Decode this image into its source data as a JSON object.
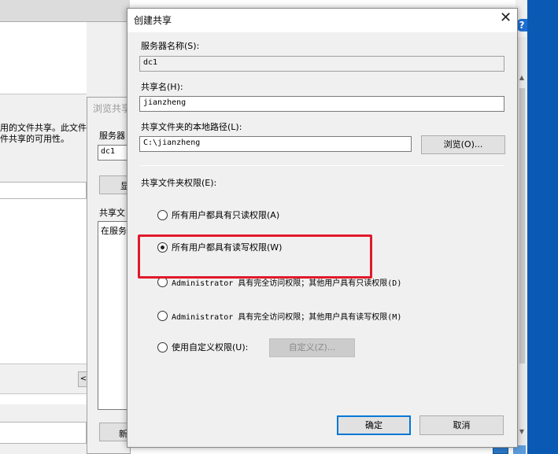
{
  "background": {
    "description_lines": "用的文件共享。此文件\n件共享的可用性。",
    "browse_dialog": {
      "title": "浏览共享",
      "server_label": "服务器",
      "server_value": "dc1",
      "show_button": "显",
      "share_label": "共享文",
      "list_item": "在服务",
      "new_button": "新"
    },
    "small_button": "<",
    "help_icon": "?"
  },
  "dialog": {
    "title": "创建共享",
    "close_glyph": "✕",
    "server_name_label": "服务器名称(S):",
    "server_name_value": "dc1",
    "share_name_label": "共享名(H):",
    "share_name_value": "jianzheng",
    "local_path_label": "共享文件夹的本地路径(L):",
    "local_path_value": "C:\\jianzheng",
    "browse_button": "浏览(O)...",
    "permissions_label": "共享文件夹权限(E):",
    "options": [
      {
        "label": "所有用户都具有只读权限(A)",
        "checked": false
      },
      {
        "label": "所有用户都具有读写权限(W)",
        "checked": true
      },
      {
        "label": "Administrator 具有完全访问权限；其他用户具有只读权限(D)",
        "checked": false
      },
      {
        "label": "Administrator 具有完全访问权限；其他用户具有读写权限(M)",
        "checked": false
      },
      {
        "label": "使用自定义权限(U):",
        "checked": false
      }
    ],
    "custom_button": "自定义(Z)...",
    "ok_button": "确定",
    "cancel_button": "取消"
  },
  "colors": {
    "highlight": "#e0192b",
    "default_button_border": "#0078d7",
    "desktop_blue": "#0a5ab4"
  }
}
